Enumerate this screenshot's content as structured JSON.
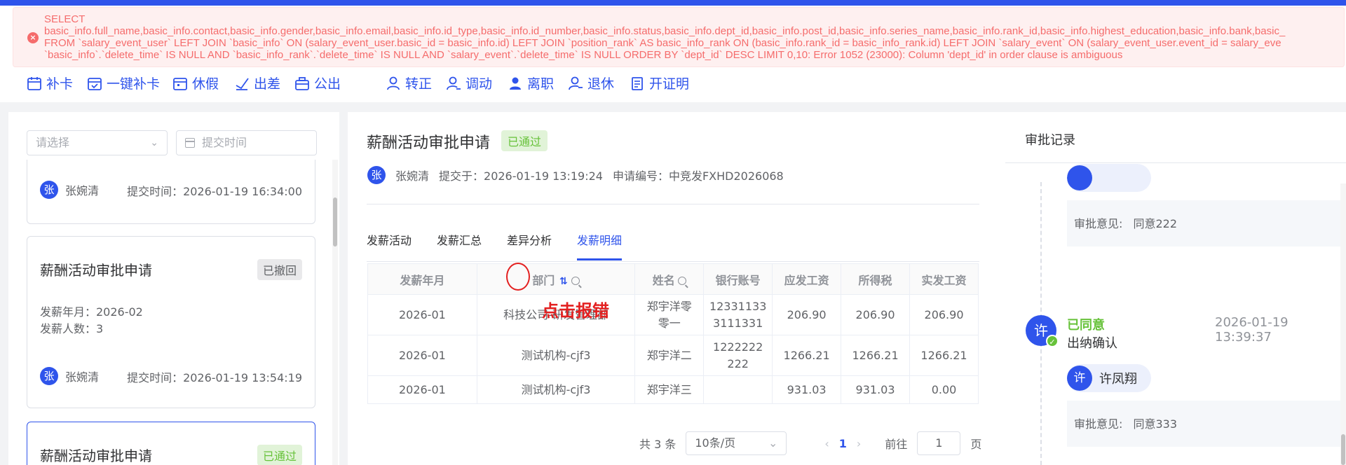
{
  "error": {
    "message": "SELECT\nbasic_info.full_name,basic_info.contact,basic_info.gender,basic_info.email,basic_info.id_type,basic_info.id_number,basic_info.status,basic_info.dept_id,basic_info.post_id,basic_info.series_name,basic_info.rank_id,basic_info.highest_education,basic_info.bank,basic_\nFROM `salary_event_user` LEFT JOIN `basic_info` ON (salary_event_user.basic_id = basic_info.id) LEFT JOIN `position_rank` AS basic_info_rank ON (basic_info.rank_id = basic_info_rank.id) LEFT JOIN `salary_event` ON (salary_event_user.event_id = salary_eve\n`basic_info`.`delete_time` IS NULL AND `basic_info_rank`.`delete_time` IS NULL AND `salary_event`.`delete_time` IS NULL ORDER BY `dept_id` DESC LIMIT 0,10: Error 1052 (23000): Column 'dept_id' in order clause is ambiguous"
  },
  "toolbar": {
    "items": [
      {
        "label": "补卡",
        "icon": "calendar-icon"
      },
      {
        "label": "一键补卡",
        "icon": "calendar-check-icon"
      },
      {
        "label": "休假",
        "icon": "calendar-leave-icon"
      },
      {
        "label": "出差",
        "icon": "travel-icon"
      },
      {
        "label": "公出",
        "icon": "briefcase-icon"
      },
      {
        "label": "转正",
        "icon": "user-icon"
      },
      {
        "label": "调动",
        "icon": "user-transfer-icon"
      },
      {
        "label": "离职",
        "icon": "user-leave-icon"
      },
      {
        "label": "退休",
        "icon": "user-retire-icon"
      },
      {
        "label": "开证明",
        "icon": "certificate-icon"
      }
    ]
  },
  "left": {
    "select_placeholder": "请选择",
    "date_placeholder": "提交时间",
    "cards": [
      {
        "name": "张婉清",
        "time_label": "提交时间：2026-01-19 16:34:00",
        "avatar": "张"
      },
      {
        "title": "薪酬活动审批申请",
        "badge": "已撤回",
        "month": "发薪年月：2026-02",
        "count": "发薪人数：3",
        "name": "张婉清",
        "time_label": "提交时间：2026-01-19 13:54:19",
        "avatar": "张"
      },
      {
        "title": "薪酬活动审批申请",
        "badge": "已通过"
      }
    ]
  },
  "middle": {
    "title": "薪酬活动审批申请",
    "badge": "已通过",
    "avatar": "张",
    "applicant": "张婉清",
    "submitted": "提交于：2026-01-19 13:19:24",
    "serial": "申请编号：中竞发FXHD2026068",
    "tabs": [
      "发薪活动",
      "发薪汇总",
      "差异分析",
      "发薪明细"
    ],
    "table": {
      "headers": [
        "发薪年月",
        "部门",
        "姓名",
        "银行账号",
        "应发工资",
        "所得税",
        "实发工资"
      ],
      "rows": [
        [
          "2026-01",
          "科技公司-研发管理部",
          "郑宇洋零\n零一",
          "12331133\n3111331",
          "206.90",
          "206.90",
          "206.90"
        ],
        [
          "2026-01",
          "测试机构-cjf3",
          "郑宇洋二",
          "1222222\n222",
          "1266.21",
          "1266.21",
          "1266.21"
        ],
        [
          "2026-01",
          "测试机构-cjf3",
          "郑宇洋三",
          "",
          "931.03",
          "931.03",
          "0.00"
        ]
      ]
    },
    "annotation": "点击报错",
    "pager": {
      "total": "共 3 条",
      "size": "10条/页",
      "page": "1",
      "goto": "前往",
      "goto_value": "1",
      "unit": "页"
    }
  },
  "right": {
    "title": "审批记录",
    "opinion1_label": "审批意见:",
    "opinion1_value": "同意222",
    "status": "已同意",
    "time": "2026-01-19 13:39:37",
    "node": "出纳确认",
    "avatar": "许",
    "approver": "许凤翔",
    "opinion2_label": "审批意见:",
    "opinion2_value": "同意333"
  }
}
